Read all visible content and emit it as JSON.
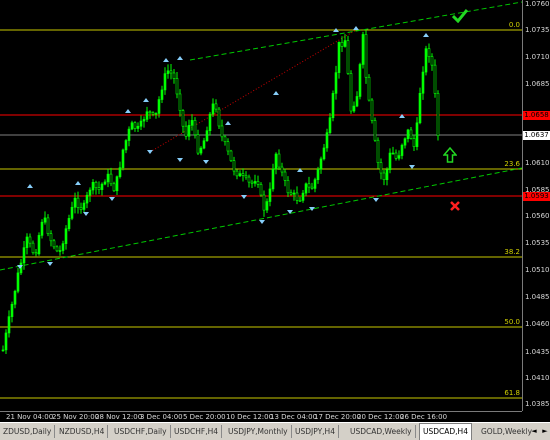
{
  "chart": {
    "symbol": "USDCAD",
    "timeframe": "H4",
    "colors": {
      "background": "#000000",
      "candle": "#00ff00",
      "fractal": "#87cefa",
      "fib_line": "#c8c800",
      "red_line": "#ff0000",
      "grey_line": "#808080",
      "channel": "#00c800",
      "dotted": "#c80000"
    },
    "price_axis": {
      "labels": [
        "1.0760",
        "1.0735",
        "1.0710",
        "1.0685",
        "1.0637",
        "1.0610",
        "1.0585",
        "1.0560",
        "1.0535",
        "1.0510",
        "1.0485",
        "1.0460",
        "1.0435",
        "1.0410",
        "1.0385",
        "1.0360"
      ],
      "price_markers": [
        {
          "text": "1.0658",
          "color": "#ff0000"
        },
        {
          "text": "1.0637",
          "color": "#ffffff"
        },
        {
          "text": "1.0593",
          "color": "#ff0000"
        }
      ]
    },
    "fib_levels": [
      {
        "label": "0.0"
      },
      {
        "label": "23.6"
      },
      {
        "label": "38.2"
      },
      {
        "label": "50.0"
      },
      {
        "label": "61.8"
      }
    ],
    "time_axis": {
      "labels": [
        "21 Nov 04:00",
        "25 Nov 20:00",
        "28 Nov 12:00",
        "3 Dec 04:00",
        "5 Dec 20:00",
        "10 Dec 12:00",
        "13 Dec 04:00",
        "17 Dec 20:00",
        "20 Dec 12:00",
        "26 Dec 16:00"
      ]
    },
    "icons": {
      "checkmark": "checkmark-icon",
      "up_arrow": "up-arrow-icon",
      "cross": "cross-icon"
    }
  },
  "tabs": {
    "items": [
      "ZDUSD,Daily",
      "NZDUSD,H4",
      "USDCHF,Daily",
      "USDCHF,H4",
      "USDJPY,Monthly",
      "USDJPY,H4",
      "USDCAD,Weekly",
      "USDCAD,H4",
      "GOLD,Weekly"
    ],
    "active": "USDCAD,H4",
    "scroll_left": "◄",
    "scroll_right": "►"
  }
}
